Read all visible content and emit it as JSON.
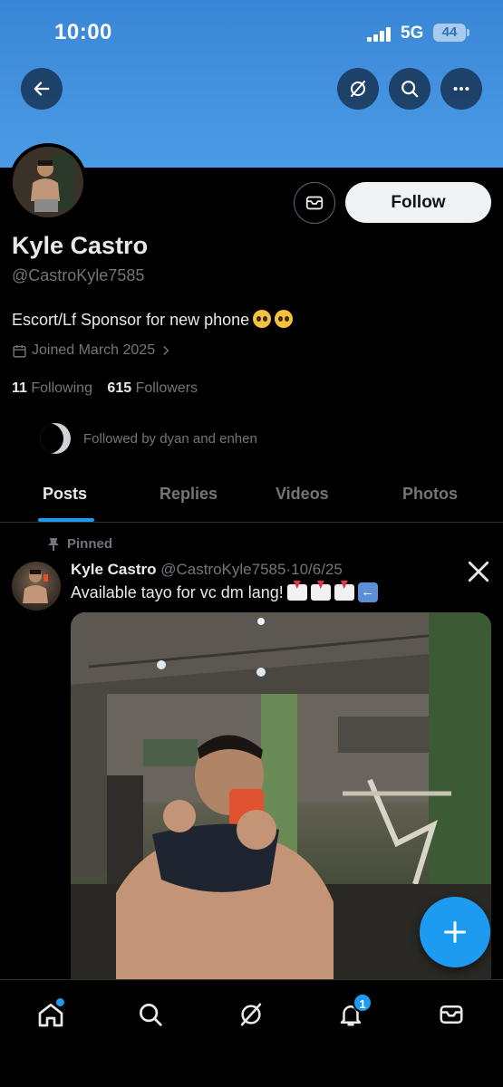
{
  "status_bar": {
    "time": "10:00",
    "network": "5G",
    "battery": "44"
  },
  "header": {
    "back_icon": "arrow-left-icon",
    "grok_icon": "grok-icon",
    "search_icon": "search-icon",
    "more_icon": "more-horizontal-icon"
  },
  "profile": {
    "name": "Kyle Castro",
    "handle": "@CastroKyle7585",
    "bio": "Escort/Lf Sponsor for new phone",
    "joined": "Joined March 2025",
    "following_count": "11",
    "following_label": "Following",
    "followers_count": "615",
    "followers_label": "Followers",
    "followed_by": "Followed by dyan and enhen",
    "follow_label": "Follow",
    "message_icon": "mail-icon"
  },
  "tabs": [
    {
      "label": "Posts",
      "active": true
    },
    {
      "label": "Replies",
      "active": false
    },
    {
      "label": "Videos",
      "active": false
    },
    {
      "label": "Photos",
      "active": false
    }
  ],
  "post": {
    "pinned_label": "Pinned",
    "author_name": "Kyle Castro",
    "author_handle": "@CastroKyle7585",
    "separator": "·",
    "date": "10/6/25",
    "text": "Available tayo for vc dm lang!"
  },
  "bottom_nav": {
    "items": [
      "home-icon",
      "search-icon",
      "grok-icon",
      "bell-icon",
      "mail-icon"
    ],
    "notification_count": "1"
  },
  "colors": {
    "accent": "#1d9bf0",
    "banner": "#4a9be6",
    "background": "#000000",
    "muted": "#71767b"
  }
}
